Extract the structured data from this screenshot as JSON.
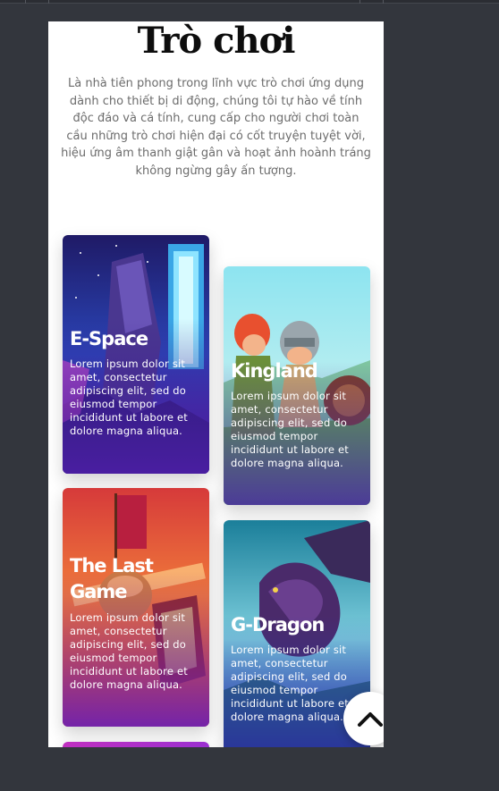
{
  "section": {
    "title": "Trò chơi",
    "intro": "Là nhà tiên phong trong lĩnh vực trò chơi ứng dụng dành cho thiết bị di động, chúng tôi tự hào về tính độc đáo và cá tính, cung cấp cho người chơi toàn cầu những trò chơi hiện đại có cốt truyện tuyệt vời, hiệu ứng âm thanh giật gân và hoạt ảnh hoành tráng không ngừng gây ấn tượng."
  },
  "games": [
    {
      "name": "E-Space",
      "description": "Lorem ipsum dolor sit amet, consectetur adipiscing elit, sed do eiusmod tempor incididunt ut labore et dolore magna aliqua."
    },
    {
      "name": "Kingland",
      "description": "Lorem ipsum dolor sit amet, consectetur adipiscing elit, sed do eiusmod tempor incididunt ut labore et dolore magna aliqua."
    },
    {
      "name": "The Last Game",
      "description": "Lorem ipsum dolor sit amet, consectetur adipiscing elit, sed do eiusmod tempor incididunt ut labore et dolore magna aliqua."
    },
    {
      "name": "G-Dragon",
      "description": "Lorem ipsum dolor sit amet, consectetur adipiscing elit, sed do eiusmod tempor incididunt ut labore et dolore magna aliqua."
    }
  ],
  "scroll_top_icon": "chevron-up-icon",
  "colors": {
    "backdrop": "#33363d",
    "page": "#ffffff",
    "title": "#0d0d0d",
    "intro_text": "#6c6c6c",
    "card_text": "#ffffff"
  }
}
